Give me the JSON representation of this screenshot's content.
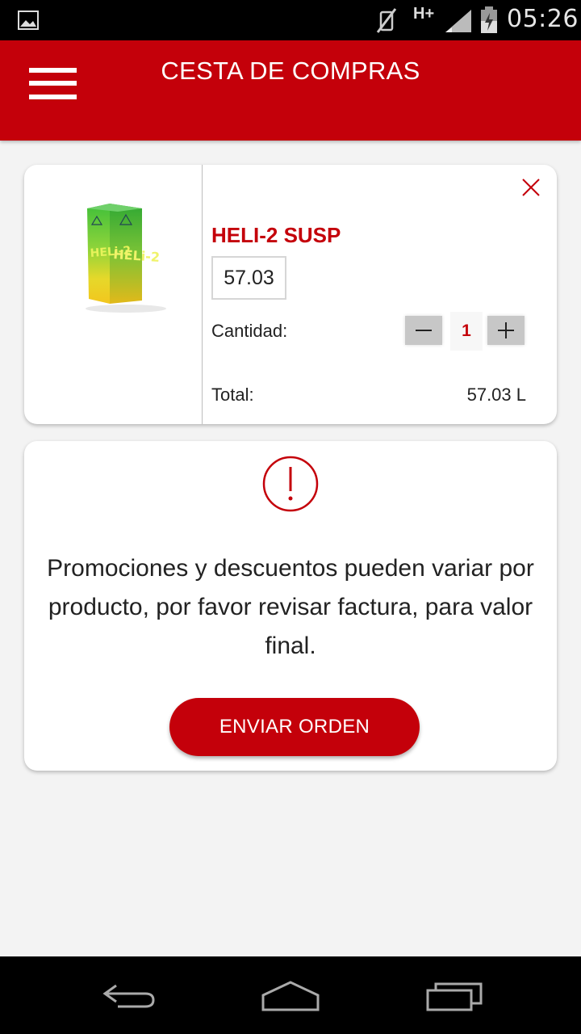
{
  "status_bar": {
    "network": "H+",
    "time": "05:26"
  },
  "app_bar": {
    "title": "CESTA DE COMPRAS"
  },
  "cart": {
    "item": {
      "name": "HELI-2 SUSP",
      "price": "57.03",
      "quantity_label": "Cantidad:",
      "quantity": "1",
      "total_label": "Total:",
      "total_value": "57.03 L"
    }
  },
  "notice": {
    "text": "Promociones y descuentos pueden variar por producto, por favor revisar factura, para valor final.",
    "button_label": "ENVIAR ORDEN"
  },
  "colors": {
    "brand": "#c4000a",
    "background": "#f3f3f3"
  }
}
